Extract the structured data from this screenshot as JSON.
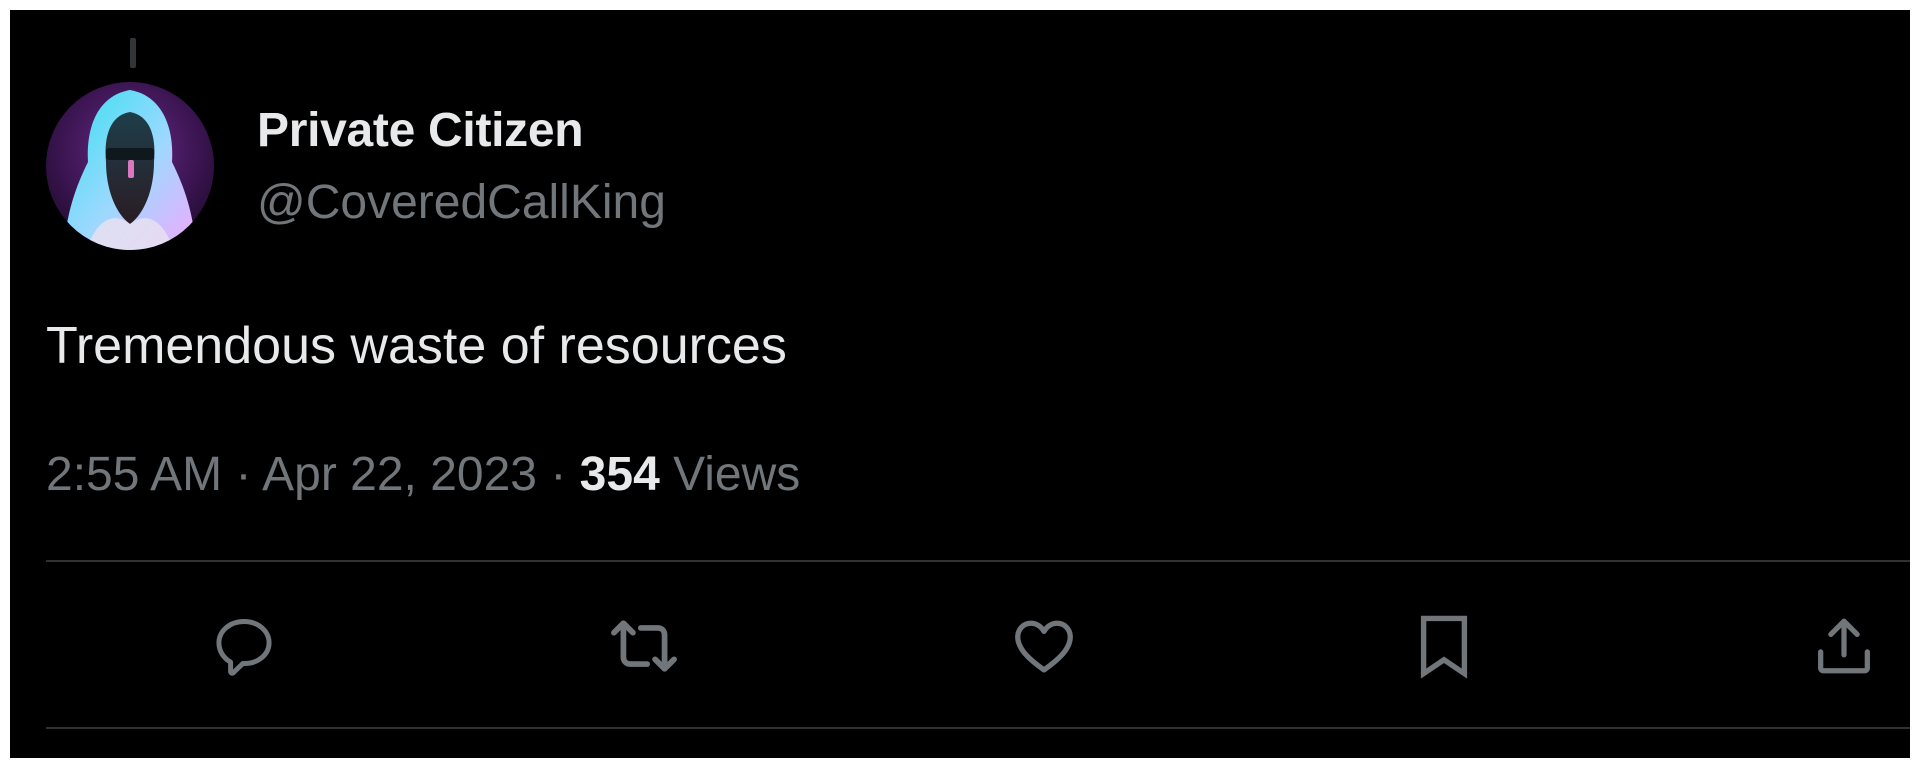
{
  "tweet": {
    "author": {
      "display_name": "Private Citizen",
      "handle": "@CoveredCallKing",
      "avatar_icon": "hooded-figure-avatar"
    },
    "text": "Tremendous waste of resources",
    "time": "2:55 AM",
    "separator": "·",
    "date": "Apr 22, 2023",
    "views_count": "354",
    "views_label": "Views"
  },
  "actions": [
    {
      "name": "reply",
      "icon": "reply-icon"
    },
    {
      "name": "retweet",
      "icon": "retweet-icon"
    },
    {
      "name": "like",
      "icon": "heart-icon"
    },
    {
      "name": "bookmark",
      "icon": "bookmark-icon"
    },
    {
      "name": "share",
      "icon": "share-icon"
    }
  ],
  "colors": {
    "background": "#000000",
    "primary_text": "#e7e9ea",
    "secondary_text": "#71767b",
    "icon": "#71767b",
    "divider": "#2f3336"
  }
}
